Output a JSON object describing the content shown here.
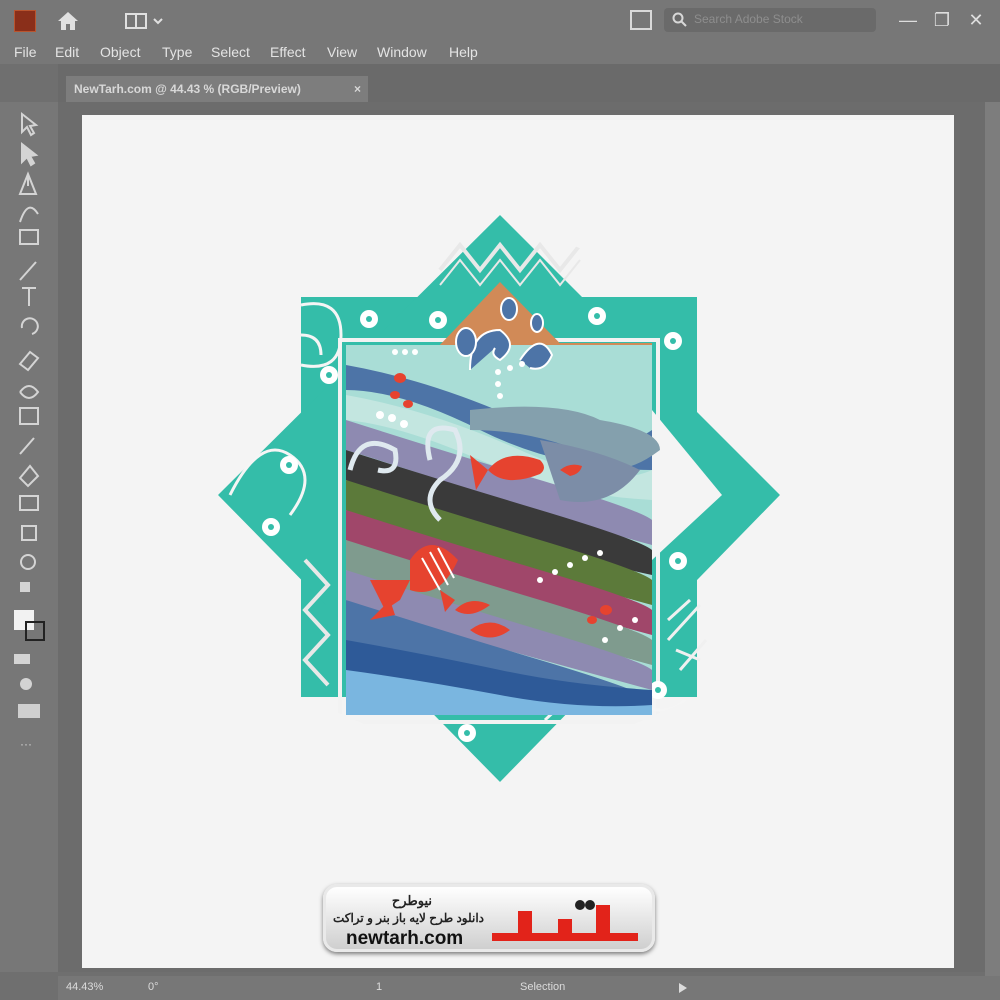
{
  "window": {
    "document_tab_title": "NewTarh.com @ 44.43 % (RGB/Preview)",
    "document_tab_close": "×",
    "search_placeholder": "Search Adobe Stock"
  },
  "menu": [
    "File",
    "Edit",
    "Object",
    "Type",
    "Select",
    "Effect",
    "View",
    "Window",
    "Help"
  ],
  "tools": [
    "selection-tool",
    "direct-selection-tool",
    "pen-tool",
    "curvature-tool",
    "rectangle-tool",
    "paintbrush-tool",
    "type-tool",
    "rotate-tool",
    "eraser-tool",
    "width-tool",
    "free-transform-tool",
    "eyedropper-tool",
    "shape-builder-tool",
    "gradient-tool",
    "artboard-tool",
    "zoom-tool",
    "fill-stroke-swatch",
    "draw-mode-tool",
    "screen-mode-tool",
    "edit-toolbar"
  ],
  "status": {
    "zoom": "44.43%",
    "angle": "0°",
    "artboard_number": "1",
    "tool_name": "Selection"
  },
  "badge": {
    "brand_fa": "نیوطرح",
    "tagline_fa": "دانلود طرح لایه باز بنر و تراکت",
    "domain": "newtarh.com",
    "logo_text": "نیوطرح"
  },
  "colors": {
    "teal": "#34bda9",
    "orange": "#d18a57",
    "fish": "#e6432f",
    "blue": "#4d74a7"
  }
}
